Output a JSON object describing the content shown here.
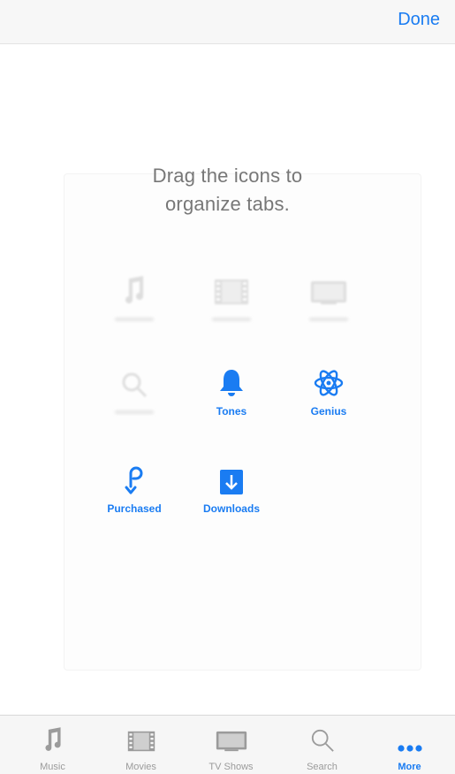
{
  "navbar": {
    "done_label": "Done"
  },
  "instruction": {
    "line1": "Drag the icons to",
    "line2": "organize tabs."
  },
  "grid": {
    "tones_label": "Tones",
    "genius_label": "Genius",
    "purchased_label": "Purchased",
    "downloads_label": "Downloads"
  },
  "tabbar": {
    "tabs": [
      {
        "label": "Music",
        "icon": "music-note-icon"
      },
      {
        "label": "Movies",
        "icon": "film-icon"
      },
      {
        "label": "TV Shows",
        "icon": "tv-icon"
      },
      {
        "label": "Search",
        "icon": "search-icon"
      },
      {
        "label": "More",
        "icon": "more-dots-icon"
      }
    ],
    "active": "More"
  },
  "colors": {
    "accent": "#1a7cf2",
    "inactive": "#9b9b9b",
    "bar_bg": "#f6f6f6"
  }
}
